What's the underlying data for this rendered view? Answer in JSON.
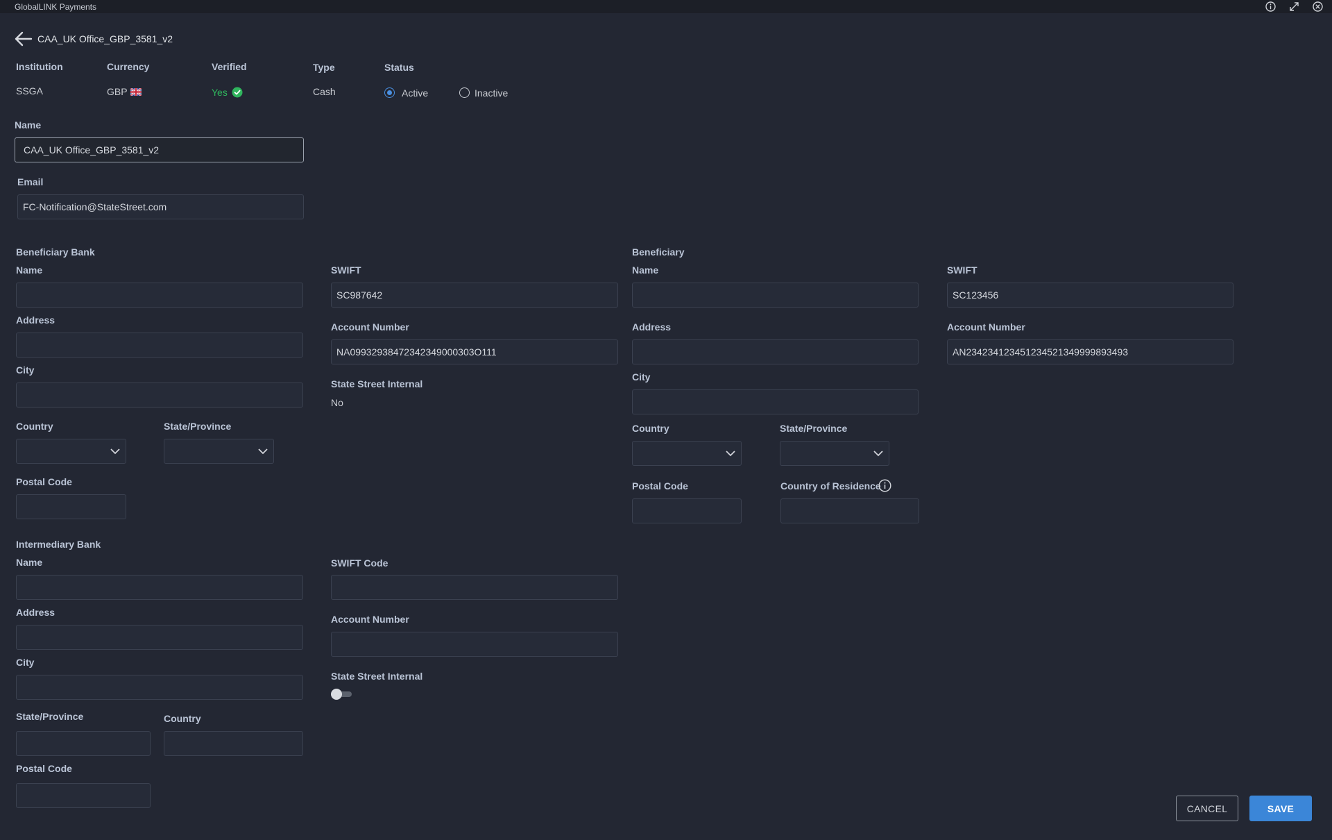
{
  "app": {
    "title": "GlobalLINK Payments"
  },
  "header": {
    "account_name": "CAA_UK Office_GBP_3581_v2"
  },
  "summary": {
    "institution_label": "Institution",
    "institution": "SSGA",
    "currency_label": "Currency",
    "currency": "GBP",
    "verified_label": "Verified",
    "verified": "Yes",
    "type_label": "Type",
    "type": "Cash",
    "status_label": "Status",
    "status_active": "Active",
    "status_inactive": "Inactive",
    "status_selected": "Active"
  },
  "form": {
    "name_label": "Name",
    "name_value": "CAA_UK Office_GBP_3581_v2",
    "email_label": "Email",
    "email_value": "FC-Notification@StateStreet.com"
  },
  "beneficiary_bank": {
    "section": "Beneficiary Bank",
    "name_label": "Name",
    "name_value": "",
    "address_label": "Address",
    "address_value": "",
    "city_label": "City",
    "city_value": "",
    "country_label": "Country",
    "state_label": "State/Province",
    "postal_label": "Postal Code",
    "postal_value": "",
    "swift_label": "SWIFT",
    "swift_value": "SC987642",
    "account_label": "Account Number",
    "account_value": "NA09932938472342349000303O111",
    "internal_label": "State Street Internal",
    "internal_value": "No"
  },
  "beneficiary": {
    "section": "Beneficiary",
    "name_label": "Name",
    "name_value": "",
    "address_label": "Address",
    "address_value": "",
    "city_label": "City",
    "city_value": "",
    "country_label": "Country",
    "state_label": "State/Province",
    "postal_label": "Postal Code",
    "postal_value": "",
    "residence_label": "Country of Residence",
    "residence_value": "",
    "swift_label": "SWIFT",
    "swift_value": "SC123456",
    "account_label": "Account Number",
    "account_value": "AN234234123451234521349999893493"
  },
  "intermediary_bank": {
    "section": "Intermediary Bank",
    "name_label": "Name",
    "name_value": "",
    "address_label": "Address",
    "address_value": "",
    "city_label": "City",
    "city_value": "",
    "state_label": "State/Province",
    "state_value": "",
    "country_label": "Country",
    "country_value": "",
    "postal_label": "Postal Code",
    "postal_value": "",
    "swift_label": "SWIFT Code",
    "swift_value": "",
    "account_label": "Account Number",
    "account_value": "",
    "internal_label": "State Street Internal",
    "internal_on": false
  },
  "actions": {
    "cancel": "CANCEL",
    "save": "SAVE"
  },
  "colors": {
    "background": "#232733",
    "accent": "#3b86d8",
    "verified": "#2fb55d"
  },
  "icons": [
    "info-icon",
    "expand-icon",
    "close-icon",
    "back-arrow-icon",
    "uk-flag-icon",
    "check-circle-icon",
    "chevron-down-icon"
  ]
}
